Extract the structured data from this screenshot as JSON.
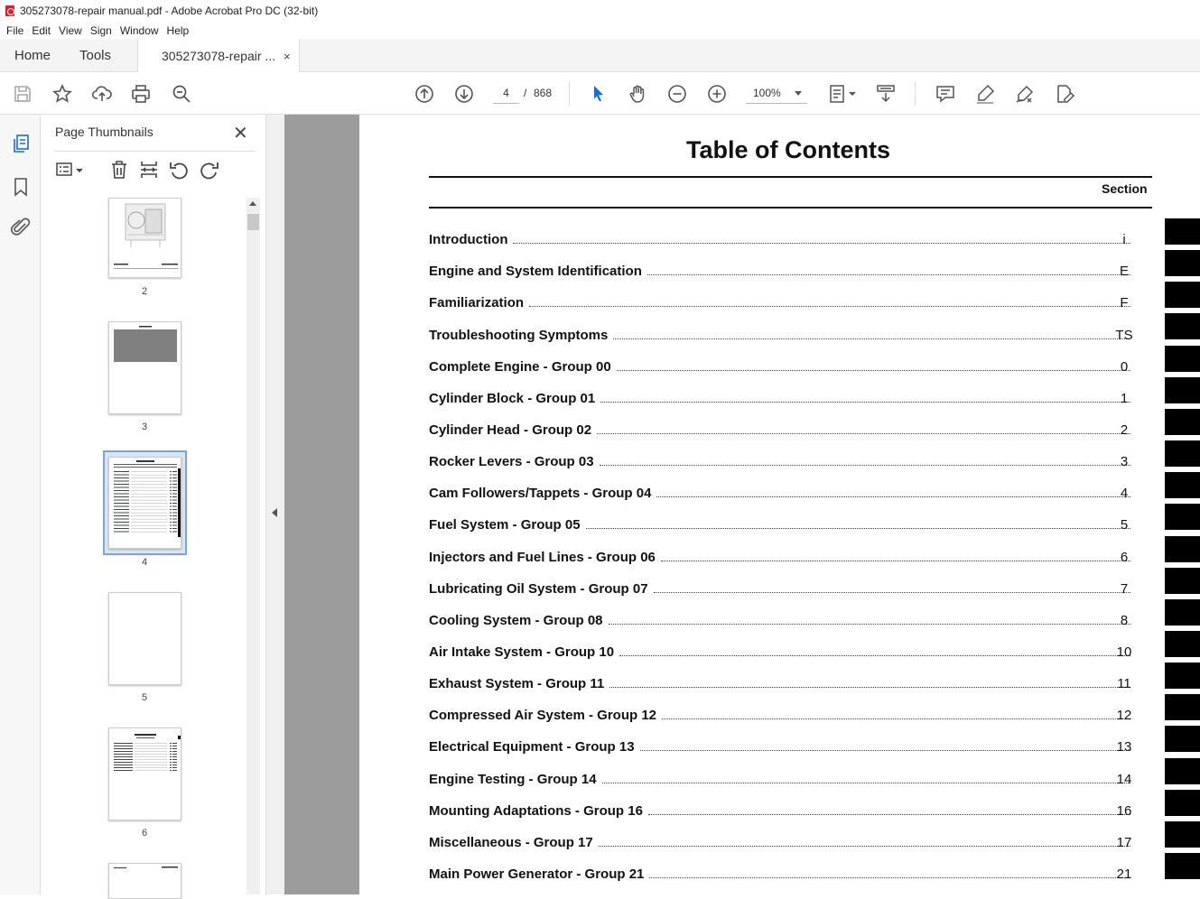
{
  "window": {
    "title": "305273078-repair manual.pdf - Adobe Acrobat Pro DC (32-bit)"
  },
  "menu": [
    "File",
    "Edit",
    "View",
    "Sign",
    "Window",
    "Help"
  ],
  "tabs": {
    "home": "Home",
    "tools": "Tools",
    "doc": "305273078-repair ...",
    "close": "×"
  },
  "toolbar": {
    "page_current": "4",
    "page_sep": "/",
    "page_total": "868",
    "zoom": "100%"
  },
  "panel": {
    "title": "Page Thumbnails",
    "close": "✕",
    "thumbnails": [
      "2",
      "3",
      "4",
      "5",
      "6"
    ],
    "selected": "4"
  },
  "document": {
    "title": "Table of Contents",
    "section_header": "Section",
    "entries": [
      {
        "label": "Introduction",
        "section": "i"
      },
      {
        "label": "Engine and System Identification",
        "section": "E"
      },
      {
        "label": "Familiarization",
        "section": "F"
      },
      {
        "label": "Troubleshooting Symptoms",
        "section": "TS"
      },
      {
        "label": "Complete Engine - Group 00",
        "section": "0"
      },
      {
        "label": "Cylinder Block - Group 01",
        "section": "1"
      },
      {
        "label": "Cylinder Head - Group 02",
        "section": "2"
      },
      {
        "label": "Rocker Levers - Group 03",
        "section": "3"
      },
      {
        "label": "Cam Followers/Tappets - Group 04",
        "section": "4"
      },
      {
        "label": "Fuel System - Group 05",
        "section": "5"
      },
      {
        "label": "Injectors and Fuel Lines - Group 06",
        "section": "6"
      },
      {
        "label": "Lubricating Oil System - Group 07",
        "section": "7"
      },
      {
        "label": "Cooling System - Group 08",
        "section": "8"
      },
      {
        "label": "Air Intake System - Group 10",
        "section": "10"
      },
      {
        "label": "Exhaust System - Group 11",
        "section": "11"
      },
      {
        "label": "Compressed Air System - Group 12",
        "section": "12"
      },
      {
        "label": "Electrical Equipment - Group 13",
        "section": "13"
      },
      {
        "label": "Engine Testing - Group 14",
        "section": "14"
      },
      {
        "label": "Mounting Adaptations - Group 16",
        "section": "16"
      },
      {
        "label": "Miscellaneous - Group 17",
        "section": "17"
      },
      {
        "label": "Main Power Generator - Group 21",
        "section": "21"
      }
    ]
  },
  "icons": [
    "pdf-icon",
    "save-icon",
    "star-icon",
    "upload-icon",
    "print-icon",
    "search-zoom-icon",
    "prev-page-icon",
    "next-page-icon",
    "select-arrow-icon",
    "hand-icon",
    "zoom-out-icon",
    "zoom-in-icon",
    "fit-page-icon",
    "scroll-mode-icon",
    "comment-icon",
    "highlight-icon",
    "sign-icon",
    "edit-icon",
    "thumbnails-icon",
    "bookmark-icon",
    "attachment-icon",
    "options-icon",
    "delete-icon",
    "extract-icon",
    "rotate-left-icon",
    "rotate-right-icon"
  ]
}
